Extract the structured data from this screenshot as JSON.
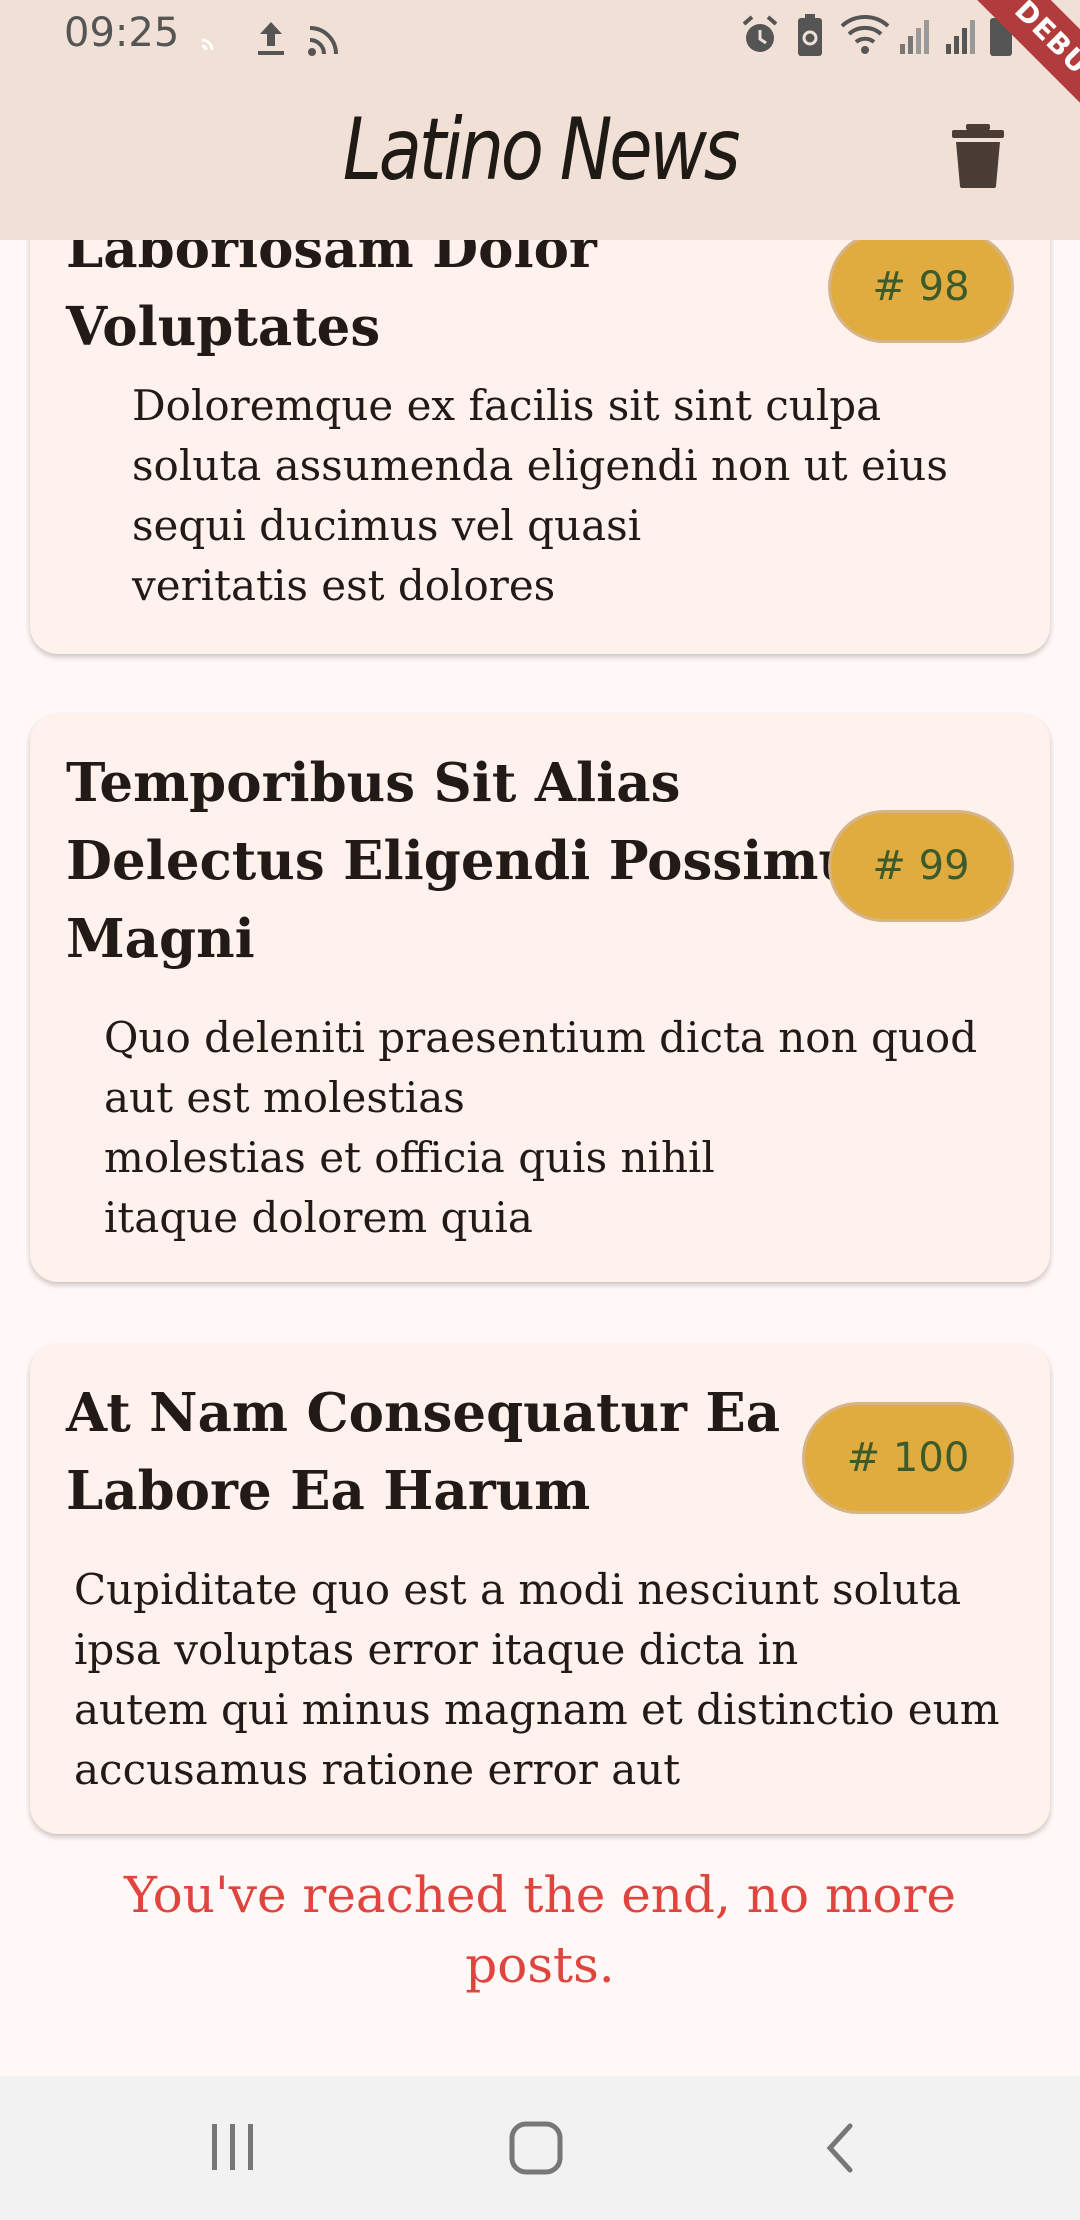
{
  "status_bar": {
    "time": "09:25"
  },
  "app_bar": {
    "title": "Latino News",
    "delete_icon": "trash-icon"
  },
  "debug_banner": {
    "label": "DEBUG"
  },
  "posts": [
    {
      "title_line1": "Laboriosam Dolor",
      "title_line2": "Voluptates",
      "badge": "# 98",
      "body_lines": [
        "Doloremque ex facilis sit sint culpa",
        "soluta assumenda eligendi non ut eius",
        "sequi ducimus vel quasi",
        "veritatis est dolores"
      ]
    },
    {
      "title_line1": "Temporibus Sit Alias",
      "title_line2": "Delectus Eligendi Possimus",
      "title_line3": "Magni",
      "badge": "# 99",
      "body_lines": [
        "Quo deleniti praesentium dicta non quod",
        "aut est molestias",
        "molestias et officia quis nihil",
        "itaque dolorem quia"
      ]
    },
    {
      "title_line1": "At Nam Consequatur Ea",
      "title_line2": "Labore Ea Harum",
      "badge": "# 100",
      "body_lines": [
        "Cupiditate quo est a modi nesciunt soluta",
        "ipsa voluptas error itaque dicta in",
        "autem qui minus magnam et distinctio eum",
        "accusamus ratione error aut"
      ]
    }
  ],
  "end_message": "You've reached the end, no more posts.",
  "colors": {
    "app_bar": "#f0e0d5",
    "card": "#fff2ec",
    "badge": "#e1ac3f",
    "end_text": "#e0443f"
  }
}
